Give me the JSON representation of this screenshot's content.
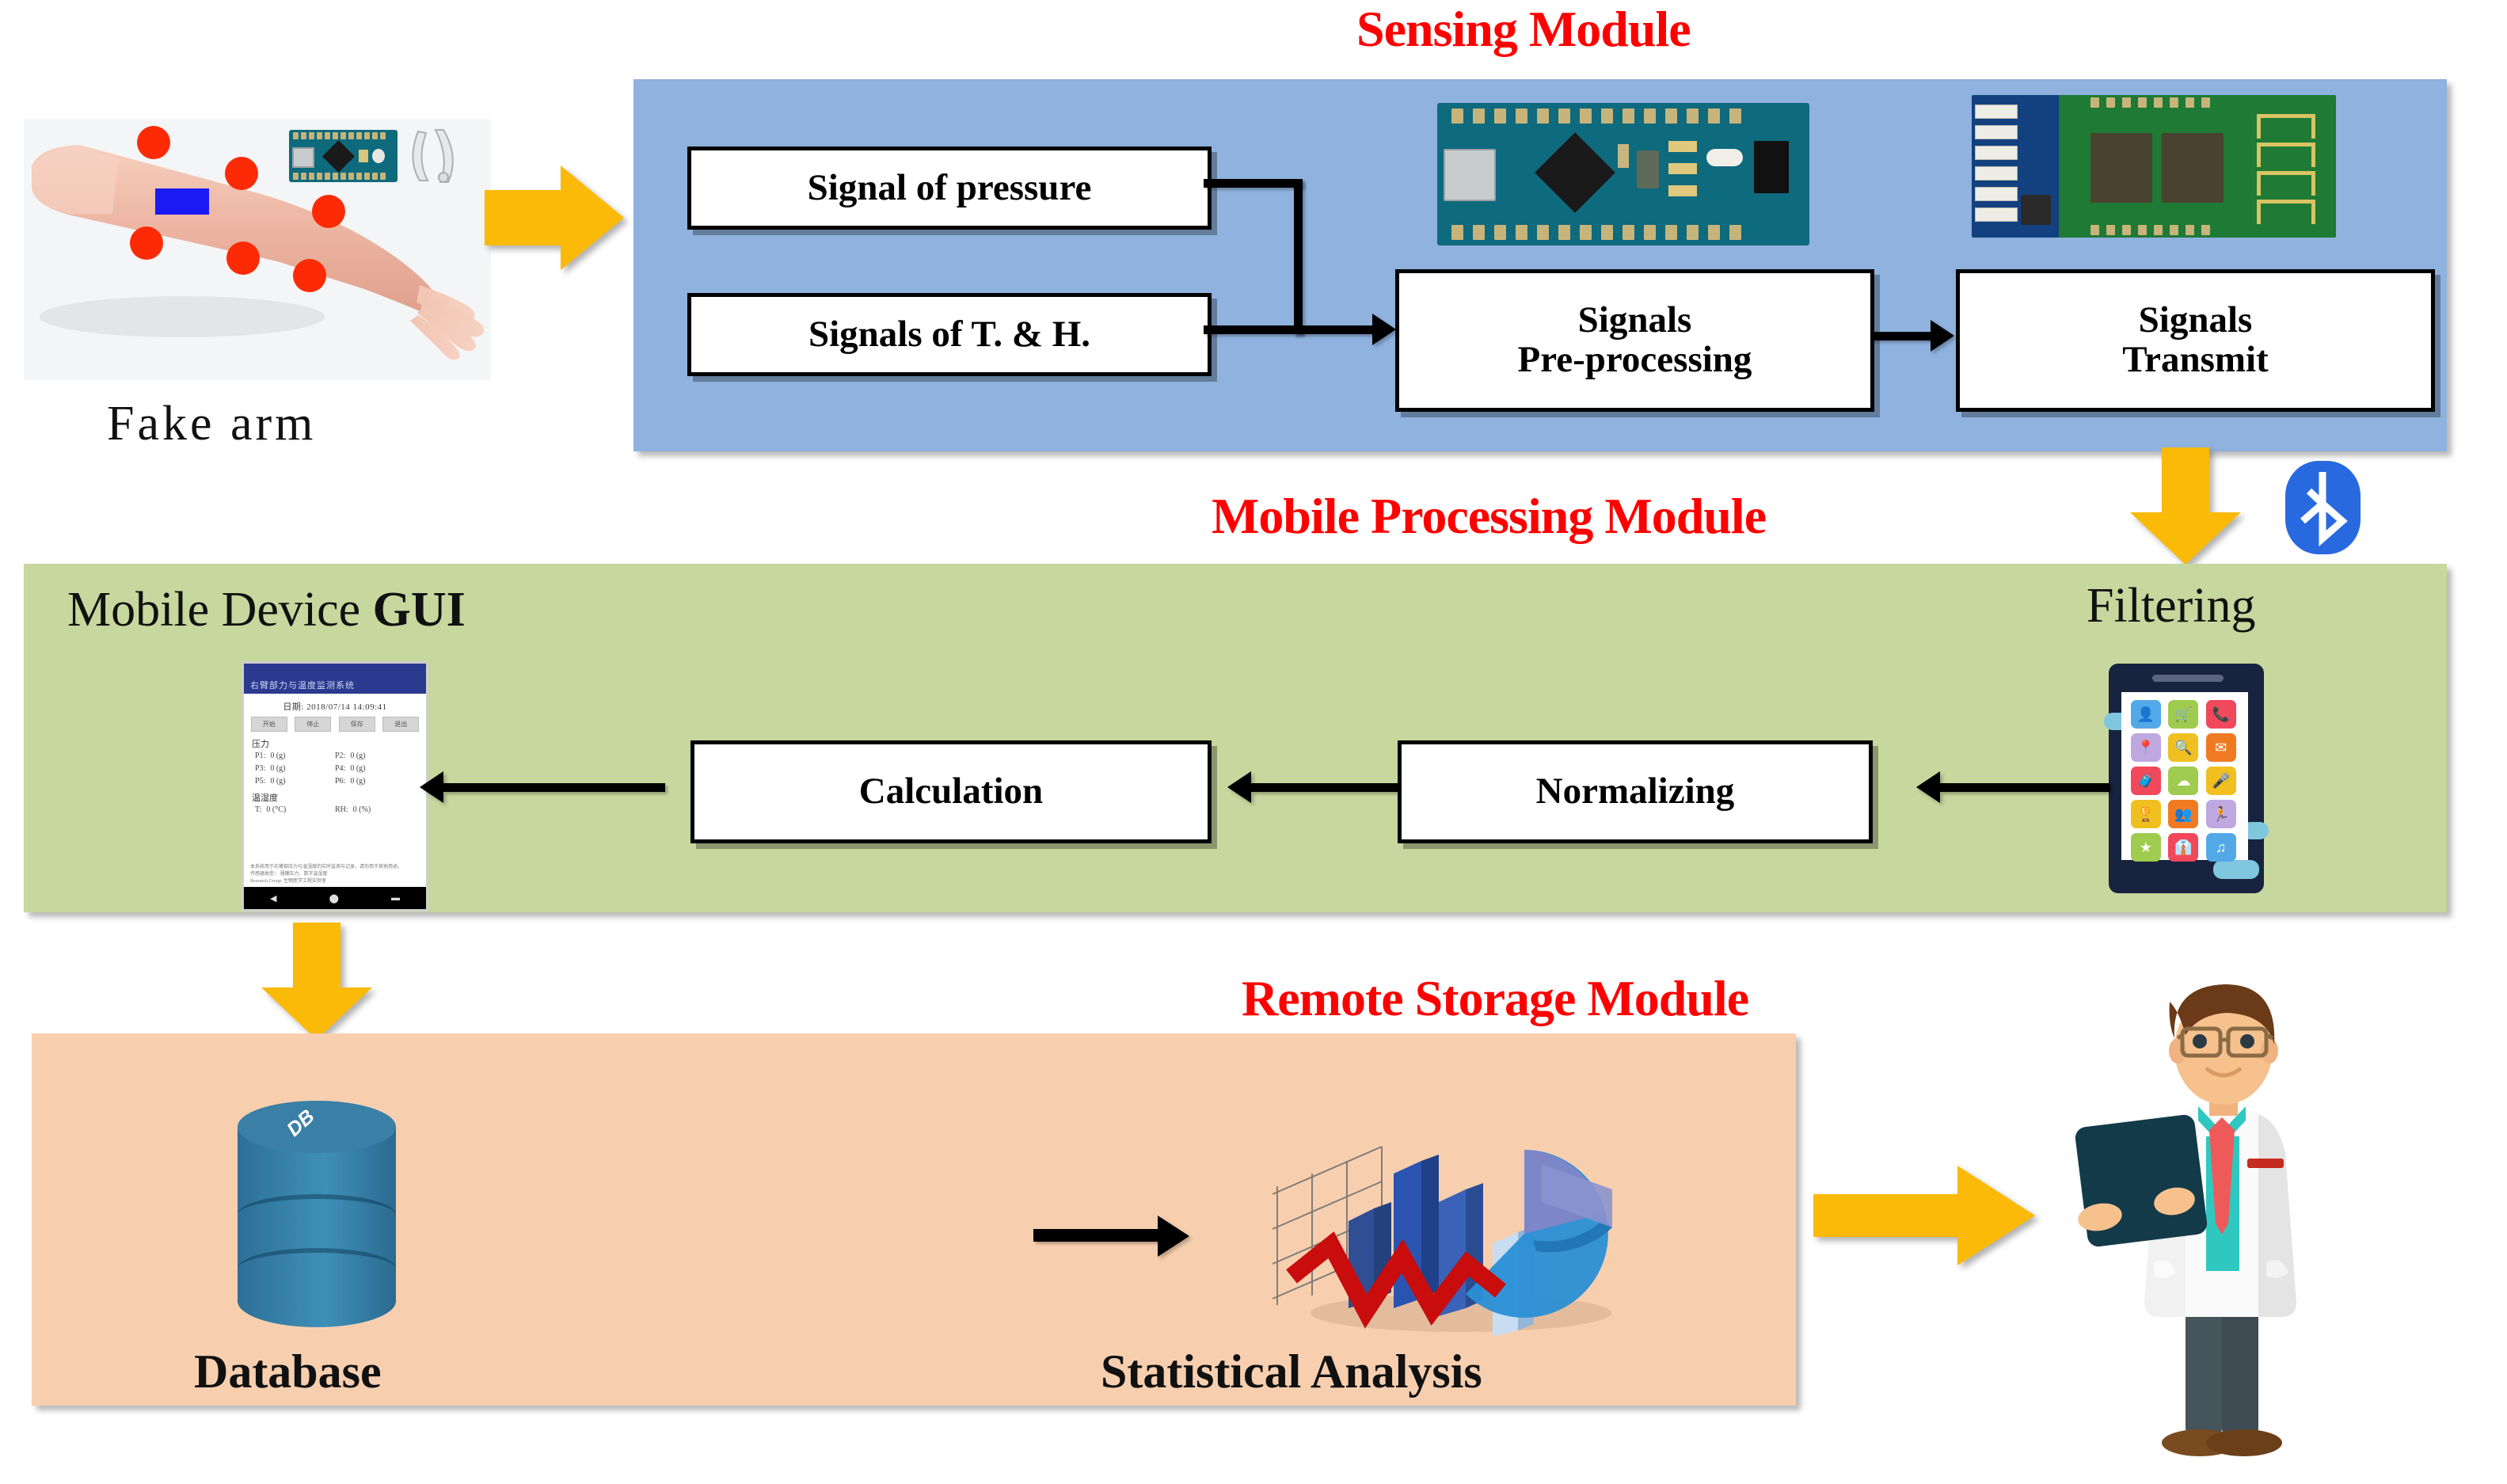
{
  "modules": {
    "sensing": {
      "title": "Sensing Module",
      "color": "#8FB2DE",
      "boxes": {
        "pressure": "Signal of pressure",
        "temp_humidity": "Signals of T. & H.",
        "preprocessing": "Signals\nPre-processing",
        "transmit": "Signals\nTransmit"
      },
      "hardware": {
        "arduino": "arduino-nano-board",
        "bluetooth": "hc05-bluetooth-module"
      }
    },
    "mobile": {
      "title": "Mobile Processing Module",
      "color": "#C7D79E",
      "gui_label_regular": "Mobile Device ",
      "gui_label_bold": "GUI",
      "filtering_label": "Filtering",
      "boxes": {
        "calculation": "Calculation",
        "normalizing": "Normalizing"
      }
    },
    "storage": {
      "title": "Remote Storage Module",
      "color": "#F7CFAF",
      "database_label": "Database",
      "statistics_label": "Statistical Analysis",
      "db_cylinder_text": "DB"
    }
  },
  "input": {
    "arm_label": "Fake  arm",
    "sensor_count": 6,
    "sensor_color": "#FC2B06",
    "strip_color": "#1A1AF5"
  },
  "gui_screenshot": {
    "app_title": "右臂部力与温度监测系统",
    "date_label": "日期:",
    "date_value": "2018/07/14 14:09:41",
    "buttons": [
      "开始",
      "停止",
      "保存",
      "退出"
    ],
    "section_pressure": "压力",
    "section_temp": "温湿度",
    "pressure_rows": [
      {
        "k": "P1:",
        "v": "0 (g)"
      },
      {
        "k": "P2:",
        "v": "0 (g)"
      },
      {
        "k": "P3:",
        "v": "0 (g)"
      },
      {
        "k": "P4:",
        "v": "0 (g)"
      },
      {
        "k": "P5:",
        "v": "0 (g)"
      },
      {
        "k": "P6:",
        "v": "0 (g)"
      }
    ],
    "temp_rows": [
      {
        "k": "T:",
        "v": "0 (°C)"
      },
      {
        "k": "RH:",
        "v": "0 (%)"
      }
    ],
    "footer_line1": "本系统用于右臂部压力与温湿度的实时监测与记录，请勿用于其他用途。",
    "footer_line2": "传感器类型： 薄膜压力、数字温湿度",
    "footer_line3": "Research Group: 生物医学工程实验室"
  },
  "accents": {
    "arrow_yellow": "#FBBA07",
    "bluetooth_blue": "#2869E0",
    "title_red": "#FF0000",
    "connector_black": "#000000"
  },
  "icons": {
    "bluetooth": "bluetooth-icon",
    "doctor": "doctor-icon",
    "database": "database-icon",
    "chart": "statistical-chart-icon",
    "phone": "smartphone-icon"
  }
}
